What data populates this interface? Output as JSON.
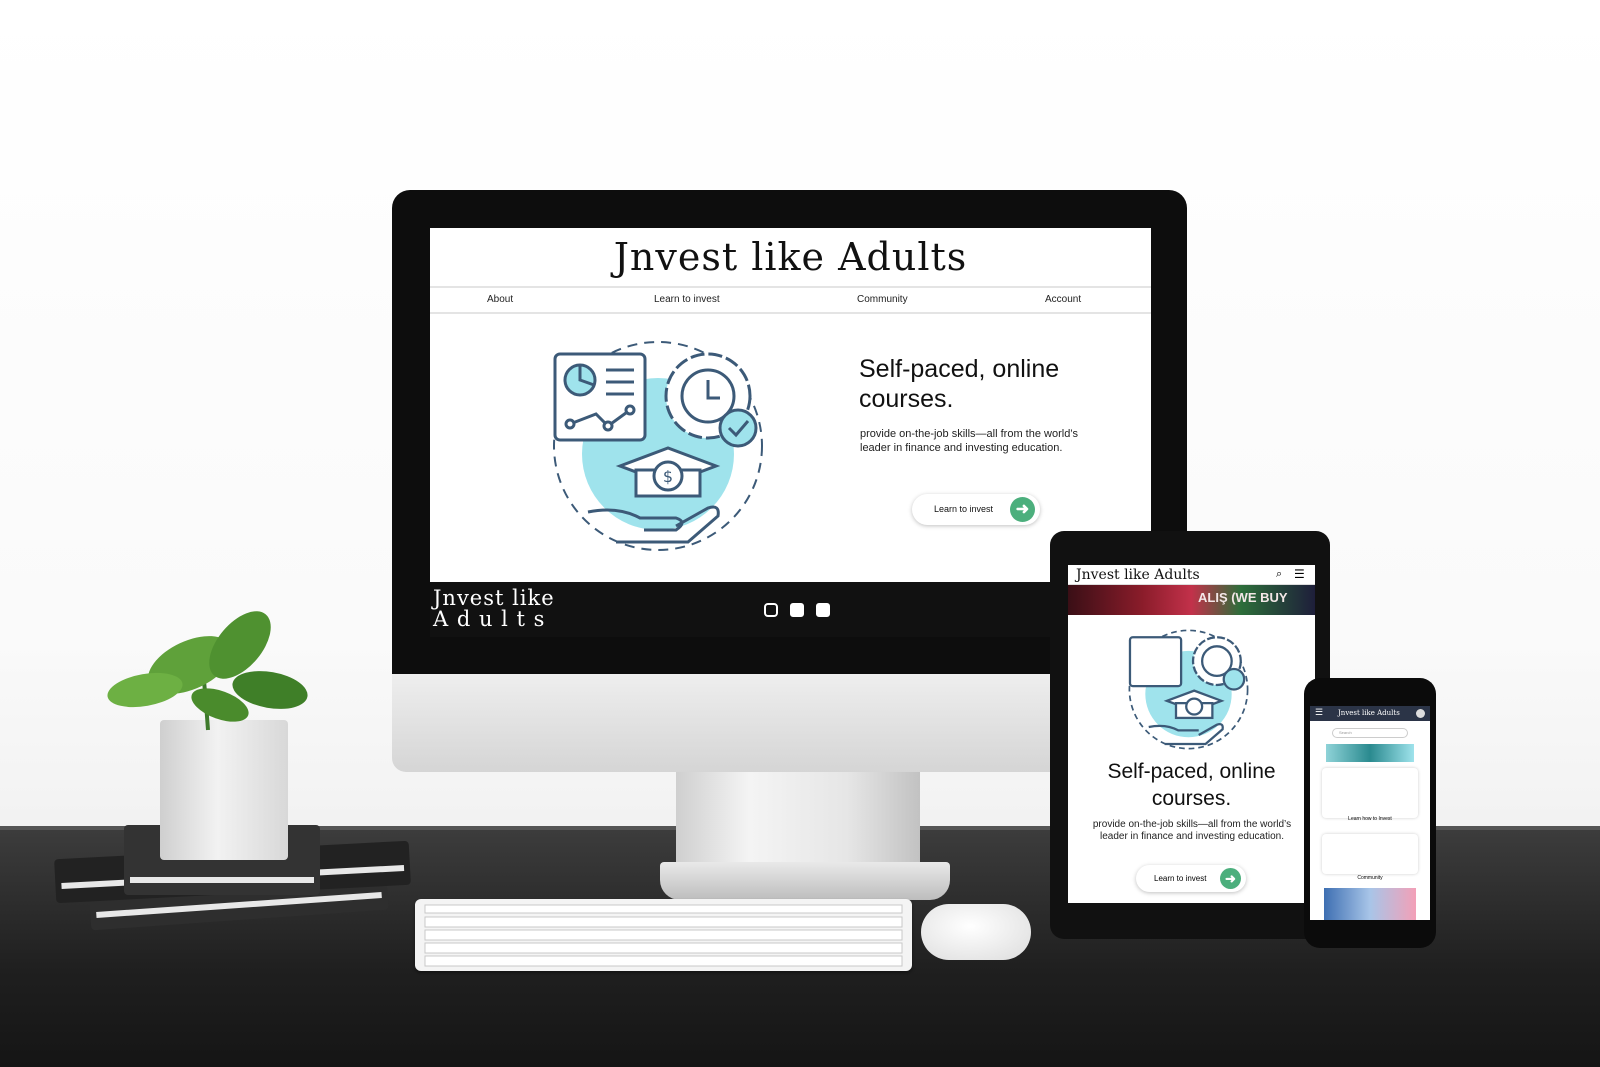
{
  "desktop": {
    "site_title": "Jnvest like Adults",
    "nav": [
      "About",
      "Learn to invest",
      "Community",
      "Account"
    ],
    "hero_heading": "Self-paced, online courses.",
    "hero_text": "provide on-the-job skills—all from the world’s leader in finance and investing education.",
    "cta_label": "Learn to invest",
    "footer_logo_line1": "Jnvest like",
    "footer_logo_line2": "A d u l t s",
    "social_icons": [
      "instagram-icon",
      "facebook-icon",
      "twitter-icon"
    ]
  },
  "tablet": {
    "site_title": "Jnvest like Adults",
    "banner_text": "ALIŞ (WE BUY",
    "hero_heading": "Self-paced, online courses.",
    "hero_text": "provide on-the-job skills—all from the world’s leader in finance and investing education.",
    "cta_label": "Learn to invest"
  },
  "phone": {
    "site_title": "Jnvest like Adults",
    "search_placeholder": "Search",
    "card1_label": "Learn how to Invest",
    "card2_label": "Community"
  },
  "colors": {
    "accent_green": "#4caf7d",
    "illustration_cyan": "#9fe3ec",
    "illustration_stroke": "#3c5a78",
    "footer_bg": "#111111",
    "phone_bar": "#2b3447"
  }
}
